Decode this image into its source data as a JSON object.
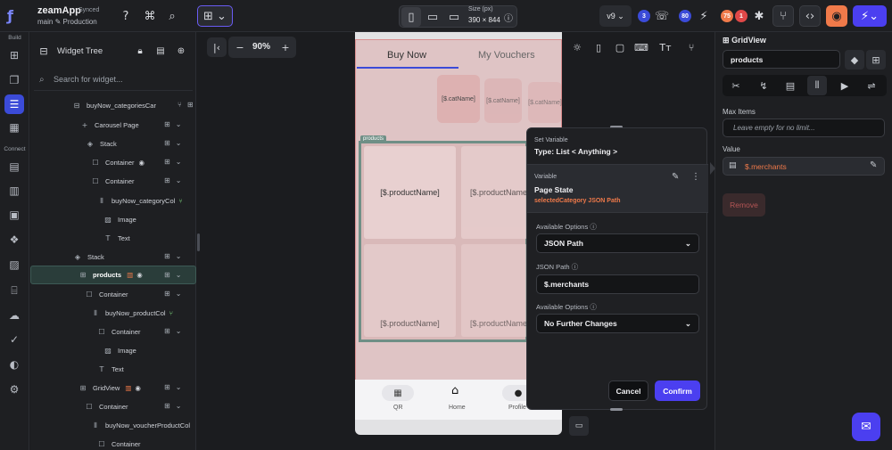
{
  "app": {
    "name": "zeamApp",
    "sync_status": "Synced",
    "branch": "main",
    "environment": "Production"
  },
  "toolbar": {
    "device_size_label": "Size (px)",
    "device_size_value": "390 × 844",
    "version": "v9",
    "badge_comments": "3",
    "badge_users": "80",
    "badge_warnings": "75",
    "badge_errors": "1"
  },
  "rail": {
    "section_build": "Build",
    "section_connect": "Connect"
  },
  "widget_tree": {
    "title": "Widget Tree",
    "search_placeholder": "Search for widget...",
    "items": [
      {
        "label": "buyNow_categoriesCar",
        "icon": "list-icon"
      },
      {
        "label": "Carousel Page",
        "icon": "plus-icon"
      },
      {
        "label": "Stack",
        "icon": "stack-icon"
      },
      {
        "label": "Container",
        "icon": "container-icon"
      },
      {
        "label": "Container",
        "icon": "container-icon"
      },
      {
        "label": "buyNow_categoryCol",
        "icon": "column-icon"
      },
      {
        "label": "Image",
        "icon": "image-icon"
      },
      {
        "label": "Text",
        "icon": "text-icon"
      },
      {
        "label": "Stack",
        "icon": "stack-icon"
      },
      {
        "label": "products",
        "icon": "grid-icon"
      },
      {
        "label": "Container",
        "icon": "container-icon"
      },
      {
        "label": "buyNow_productCol",
        "icon": "column-icon"
      },
      {
        "label": "Container",
        "icon": "container-icon"
      },
      {
        "label": "Image",
        "icon": "image-icon"
      },
      {
        "label": "Text",
        "icon": "text-icon"
      },
      {
        "label": "GridView",
        "icon": "grid-icon"
      },
      {
        "label": "Container",
        "icon": "container-icon"
      },
      {
        "label": "buyNow_voucherProductCol",
        "icon": "column-icon"
      },
      {
        "label": "Container",
        "icon": "container-icon"
      }
    ]
  },
  "canvas": {
    "zoom": "90%"
  },
  "phone": {
    "tab_active": "Buy Now",
    "tab_inactive": "My Vouchers",
    "cat_label": "[$.catName]",
    "products_tag": "products",
    "product_name": "[$.productName]",
    "nav": [
      "QR",
      "Home",
      "Profile"
    ]
  },
  "popup": {
    "header_label": "Set Variable",
    "header_type": "Type: List < Anything >",
    "var_label": "Variable",
    "var_name": "Page State",
    "var_path": "selectedCategory JSON Path",
    "opt1_label": "Available Options",
    "opt1_value": "JSON Path",
    "json_path_label": "JSON Path",
    "json_path_value": "$.merchants",
    "opt2_label": "Available Options",
    "opt2_value": "No Further Changes",
    "cancel": "Cancel",
    "confirm": "Confirm"
  },
  "right_panel": {
    "title": "GridView",
    "name_value": "products",
    "max_items_label": "Max Items",
    "max_items_placeholder": "Leave empty for no limit...",
    "value_label": "Value",
    "value_binding": "$.merchants",
    "remove": "Remove"
  },
  "colors": {
    "accent": "#4b3ff0",
    "orange": "#f07a4a",
    "selection": "#2a3d3a"
  }
}
